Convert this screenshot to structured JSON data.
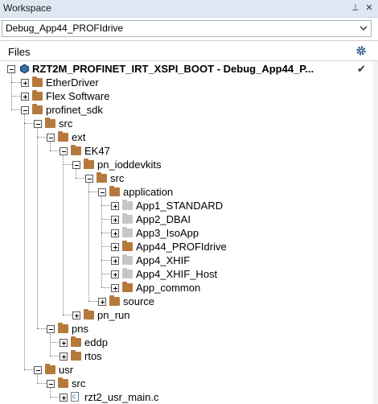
{
  "window": {
    "title": "Workspace",
    "pin_glyph": "⊥",
    "close_glyph": "✕"
  },
  "configuration": {
    "selected": "Debug_App44_PROFIdrive"
  },
  "files_header": {
    "label": "Files",
    "settings_icon": "gear-icon"
  },
  "project": {
    "name": "RZT2M_PROFINET_IRT_XSPI_BOOT - Debug_App44_P...",
    "check": "✔"
  },
  "tree": [
    {
      "label": "EtherDriver",
      "depth": 1,
      "expanded": false,
      "type": "folder"
    },
    {
      "label": "Flex Software",
      "depth": 1,
      "expanded": false,
      "type": "folder"
    },
    {
      "label": "profinet_sdk",
      "depth": 1,
      "expanded": true,
      "type": "folder"
    },
    {
      "label": "src",
      "depth": 2,
      "expanded": true,
      "type": "folder"
    },
    {
      "label": "ext",
      "depth": 3,
      "expanded": true,
      "type": "folder"
    },
    {
      "label": "EK47",
      "depth": 4,
      "expanded": true,
      "type": "folder"
    },
    {
      "label": "pn_ioddevkits",
      "depth": 5,
      "expanded": true,
      "type": "folder"
    },
    {
      "label": "src",
      "depth": 6,
      "expanded": true,
      "type": "folder"
    },
    {
      "label": "application",
      "depth": 7,
      "expanded": true,
      "type": "folder"
    },
    {
      "label": "App1_STANDARD",
      "depth": 8,
      "expanded": false,
      "type": "folder-gray"
    },
    {
      "label": "App2_DBAI",
      "depth": 8,
      "expanded": false,
      "type": "folder-gray"
    },
    {
      "label": "App3_IsoApp",
      "depth": 8,
      "expanded": false,
      "type": "folder-gray"
    },
    {
      "label": "App44_PROFIdrive",
      "depth": 8,
      "expanded": false,
      "type": "folder"
    },
    {
      "label": "App4_XHIF",
      "depth": 8,
      "expanded": false,
      "type": "folder-gray"
    },
    {
      "label": "App4_XHIF_Host",
      "depth": 8,
      "expanded": false,
      "type": "folder-gray"
    },
    {
      "label": "App_common",
      "depth": 8,
      "expanded": false,
      "type": "folder"
    },
    {
      "label": "source",
      "depth": 7,
      "expanded": false,
      "type": "folder"
    },
    {
      "label": "pn_run",
      "depth": 5,
      "expanded": false,
      "type": "folder"
    },
    {
      "label": "pns",
      "depth": 3,
      "expanded": true,
      "type": "folder"
    },
    {
      "label": "eddp",
      "depth": 4,
      "expanded": false,
      "type": "folder"
    },
    {
      "label": "rtos",
      "depth": 4,
      "expanded": false,
      "type": "folder"
    },
    {
      "label": "usr",
      "depth": 2,
      "expanded": true,
      "type": "folder"
    },
    {
      "label": "src",
      "depth": 3,
      "expanded": true,
      "type": "folder"
    },
    {
      "label": "rzt2_usr_main.c",
      "depth": 4,
      "expanded": false,
      "type": "file"
    }
  ],
  "colors": {
    "folder": "#b5793d",
    "folder_excluded": "#c6c6c6",
    "header_bg": "#dfe7f2",
    "project_icon": "#1f4e79"
  }
}
